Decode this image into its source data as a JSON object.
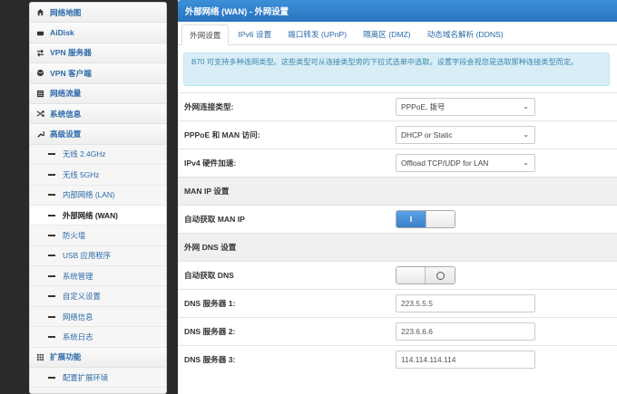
{
  "sidebar": {
    "items": [
      {
        "label": "网络地图",
        "icon": "home-icon"
      },
      {
        "label": "AiDisk",
        "icon": "disk-icon"
      },
      {
        "label": "VPN 服务器",
        "icon": "transfer-icon"
      },
      {
        "label": "VPN 客户端",
        "icon": "globe-icon"
      },
      {
        "label": "网络流量",
        "icon": "traffic-icon"
      },
      {
        "label": "系统信息",
        "icon": "shuffle-icon"
      },
      {
        "label": "高级设置",
        "icon": "wrench-icon"
      }
    ],
    "sub_items": [
      "无线 2.4GHz",
      "无线 5GHz",
      "内部网络 (LAN)",
      "外部网络 (WAN)",
      "防火墙",
      "USB 应用程序",
      "系统管理",
      "自定义设置",
      "网络信息",
      "系统日志"
    ],
    "ext_label": "扩展功能",
    "ext_sub": "配置扩展环境",
    "active_sub": "外部网络 (WAN)"
  },
  "main": {
    "title": "外部网络 (WAN) - 外网设置",
    "tabs": [
      "外网设置",
      "IPv6 设置",
      "端口转发 (UPnP)",
      "隔离区 (DMZ)",
      "动态域名解析 (DDNS)"
    ],
    "info": "B70 可支持多种连网类型。这些类型可从连接类型旁的下拉式选单中选取。设置字段会视您是选取那种连接类型而定。",
    "fields": {
      "wan_type": {
        "label": "外网连接类型:",
        "value": "PPPoE, 拨号"
      },
      "pppoe_man": {
        "label": "PPPoE 和 MAN 访问:",
        "value": "DHCP or Static"
      },
      "ipv4_accel": {
        "label": "IPv4 硬件加速:",
        "value": "Offload TCP/UDP for LAN"
      }
    },
    "man_section": "MAN IP 设置",
    "man_auto": {
      "label": "自动获取 MAN IP",
      "state": "on",
      "on_text": "I"
    },
    "dns_section": "外网 DNS 设置",
    "dns_auto": {
      "label": "自动获取 DNS",
      "state": "off"
    },
    "dns": [
      {
        "label": "DNS 服务器 1:",
        "value": "223.5.5.5"
      },
      {
        "label": "DNS 服务器 2:",
        "value": "223.6.6.6"
      },
      {
        "label": "DNS 服务器 3:",
        "value": "114.114.114.114"
      }
    ]
  },
  "colors": {
    "accent": "#2b73bf",
    "link": "#2b6aa8",
    "info_bg": "#d9edf7"
  }
}
